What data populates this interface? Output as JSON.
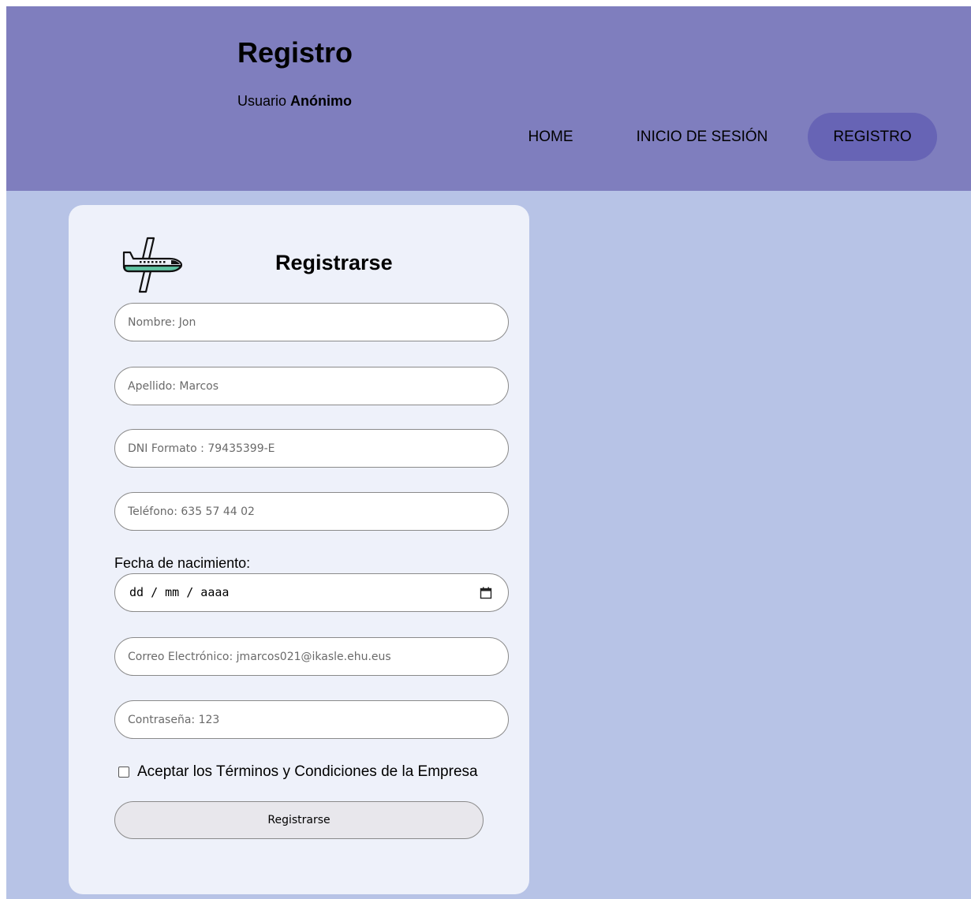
{
  "header": {
    "title": "Registro",
    "user_prefix": "Usuario",
    "user_name": "Anónimo",
    "nav": [
      {
        "label": "HOME",
        "active": false
      },
      {
        "label": "INICIO DE SESIÓN",
        "active": false
      },
      {
        "label": "REGISTRO",
        "active": true
      }
    ]
  },
  "form": {
    "logo_icon": "airplane-icon",
    "title": "Registrarse",
    "fields": {
      "nombre": {
        "placeholder": "Nombre: Jon",
        "value": ""
      },
      "apellido": {
        "placeholder": "Apellido: Marcos",
        "value": ""
      },
      "dni": {
        "placeholder": "DNI Formato : 79435399-E",
        "value": ""
      },
      "telefono": {
        "placeholder": "Teléfono: 635 57 44 02",
        "value": ""
      },
      "email": {
        "placeholder": "Correo Electrónico: jmarcos021@ikasle.ehu.eus",
        "value": ""
      },
      "password": {
        "placeholder": "Contraseña: 123",
        "value": ""
      }
    },
    "fecha_label": "Fecha de nacimiento:",
    "fecha_placeholder": "dd / mm / aaaa",
    "terms_label": "Aceptar los Términos y Condiciones de la Empresa",
    "terms_checked": false,
    "submit_label": "Registrarse"
  },
  "colors": {
    "header_bg": "#7f7ebe",
    "nav_active_bg": "#6764b5",
    "page_bg": "#b7c3e6",
    "card_bg": "#eef1fa",
    "button_bg": "#e8e7ec"
  }
}
